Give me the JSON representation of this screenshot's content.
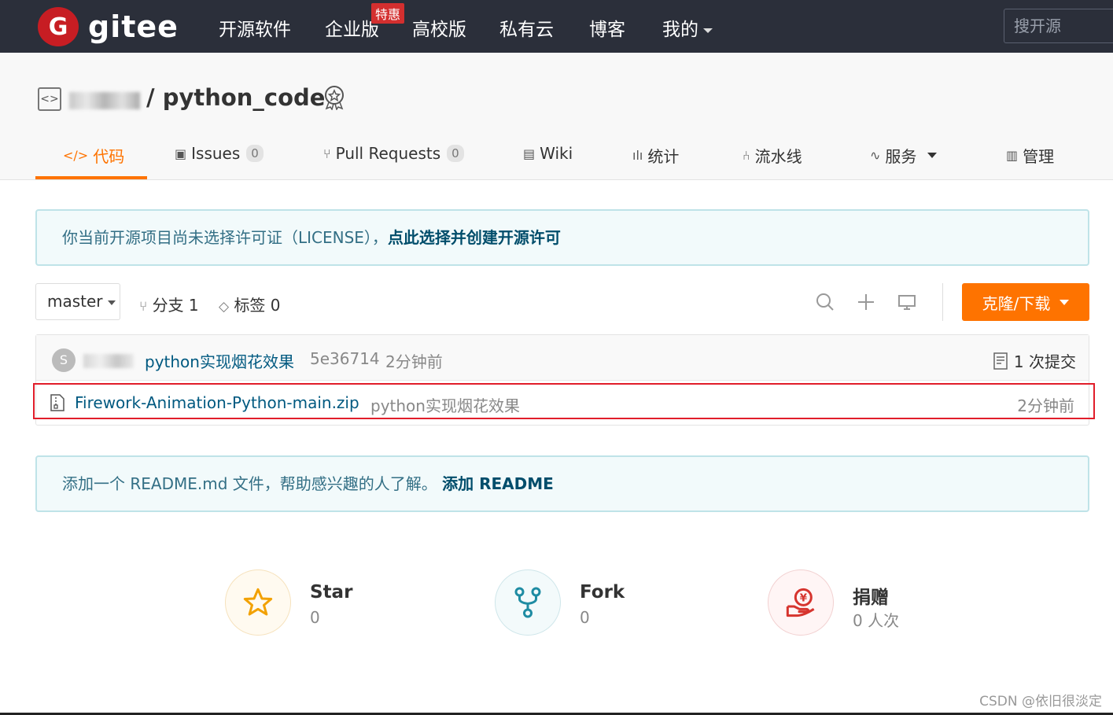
{
  "nav": {
    "logo_letter": "G",
    "logo_text": "gitee",
    "items": [
      "开源软件",
      "企业版",
      "高校版",
      "私有云",
      "博客",
      "我的"
    ],
    "promo_badge": "特惠",
    "search_placeholder": "搜开源"
  },
  "repo": {
    "title": "/ python_code"
  },
  "tabs": [
    {
      "label": "代码",
      "count": null
    },
    {
      "label": "Issues",
      "count": "0"
    },
    {
      "label": "Pull Requests",
      "count": "0"
    },
    {
      "label": "Wiki",
      "count": null
    },
    {
      "label": "统计",
      "count": null
    },
    {
      "label": "流水线",
      "count": null
    },
    {
      "label": "服务",
      "count": null
    },
    {
      "label": "管理",
      "count": null
    }
  ],
  "license_notice": {
    "text": "你当前开源项目尚未选择许可证（LICENSE），",
    "link": "点此选择并创建开源许可"
  },
  "branch_bar": {
    "branch": "master",
    "branches": "分支 1",
    "tags": "标签 0",
    "clone_label": "克隆/下载"
  },
  "commit": {
    "avatar_letter": "S",
    "message": "python实现烟花效果",
    "hash": "5e36714",
    "time": "2分钟前",
    "count": "1 次提交"
  },
  "files": [
    {
      "name": "Firework-Animation-Python-main.zip",
      "message": "python实现烟花效果",
      "time": "2分钟前"
    }
  ],
  "readme_notice": {
    "text": "添加一个 README.md 文件，帮助感兴趣的人了解。",
    "link": "添加 README"
  },
  "stats": [
    {
      "label": "Star",
      "value": "0"
    },
    {
      "label": "Fork",
      "value": "0"
    },
    {
      "label": "捐赠",
      "value": "0 人次"
    }
  ],
  "watermark": "CSDN @依旧很淡定",
  "colors": {
    "accent": "#fe7300",
    "nav_bg": "#2b2f3a",
    "brand_red": "#c71d23",
    "link": "#005980",
    "highlight": "#e11d2a"
  }
}
